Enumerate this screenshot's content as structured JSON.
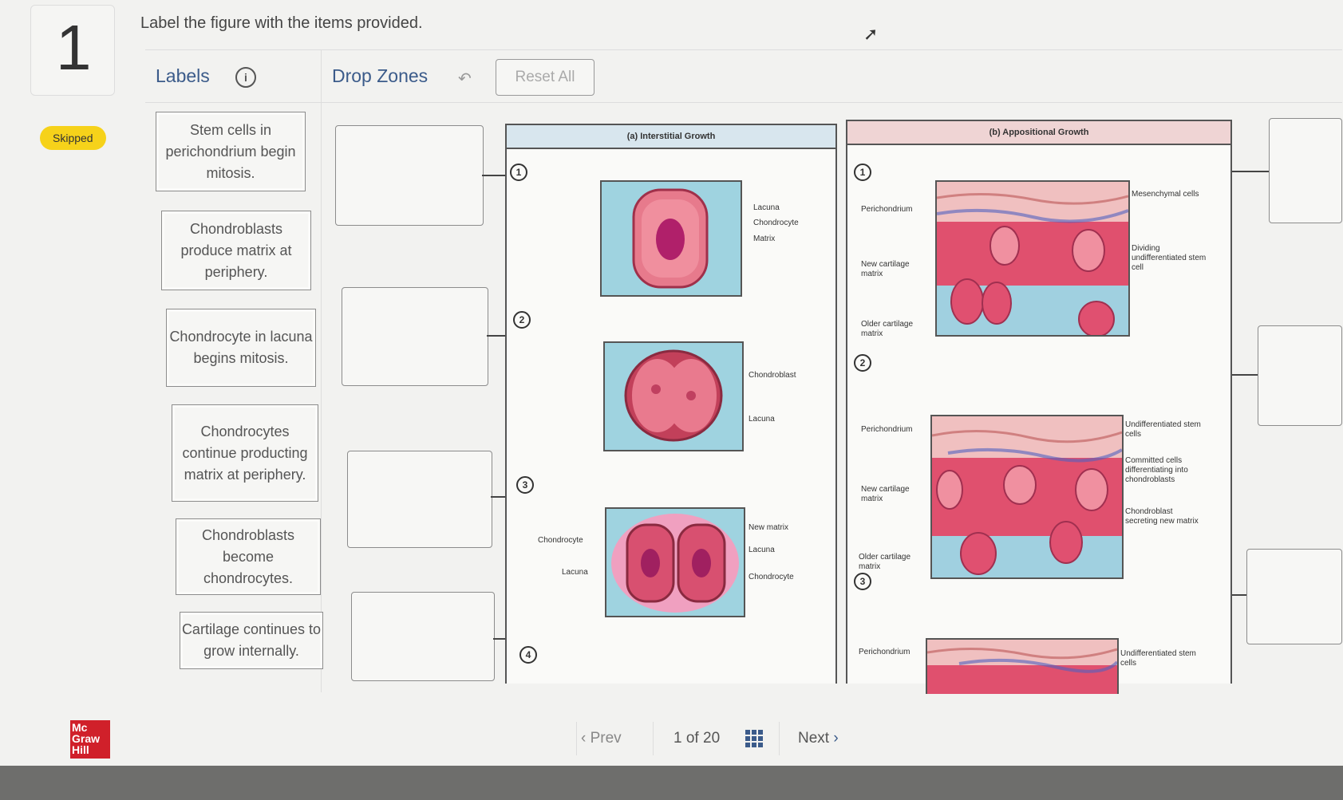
{
  "question": {
    "number": "1",
    "status": "Skipped",
    "prompt": "Label the figure with the items provided."
  },
  "toolbar": {
    "labels_heading": "Labels",
    "dropzones_heading": "Drop Zones",
    "reset_label": "Reset All"
  },
  "labels": [
    "Stem cells in perichondrium begin mitosis.",
    "Chondroblasts produce matrix at periphery.",
    "Chondrocyte in lacuna begins mitosis.",
    "Chondrocytes continue producting matrix at periphery.",
    "Chondroblasts become chondrocytes.",
    "Cartilage continues to grow internally."
  ],
  "figure": {
    "interstitial": {
      "title": "(a) Interstitial Growth",
      "steps": [
        "1",
        "2",
        "3",
        "4"
      ],
      "step1_labels": [
        "Lacuna",
        "Chondrocyte",
        "Matrix"
      ],
      "step2_labels": [
        "Chondroblast",
        "Lacuna"
      ],
      "step3_left": [
        "Chondrocyte",
        "Lacuna"
      ],
      "step3_right": [
        "New matrix",
        "Lacuna",
        "Chondrocyte"
      ]
    },
    "appositional": {
      "title": "(b) Appositional Growth",
      "steps": [
        "1",
        "2",
        "3"
      ],
      "step1_left": [
        "Perichondrium",
        "New cartilage matrix",
        "Older cartilage matrix"
      ],
      "step1_right": [
        "Mesenchymal cells",
        "Dividing undifferentiated stem cell"
      ],
      "step2_left": [
        "Perichondrium",
        "New cartilage matrix",
        "Older cartilage matrix"
      ],
      "step2_right": [
        "Undifferentiated stem cells",
        "Committed cells differentiating into chondroblasts",
        "Chondroblast secreting new matrix"
      ],
      "step3_left": [
        "Perichondrium"
      ],
      "step3_right": [
        "Undifferentiated stem cells"
      ]
    }
  },
  "footer": {
    "logo": "Mc Graw Hill",
    "prev": "Prev",
    "page_current": "1",
    "page_of": "of",
    "page_total": "20",
    "next": "Next"
  },
  "colors": {
    "accent": "#3b5b8a",
    "skipped_badge": "#f6d21a",
    "logo": "#d0202a",
    "tissue_pink": "#e0506e",
    "tissue_blue": "#9fd3e0"
  }
}
